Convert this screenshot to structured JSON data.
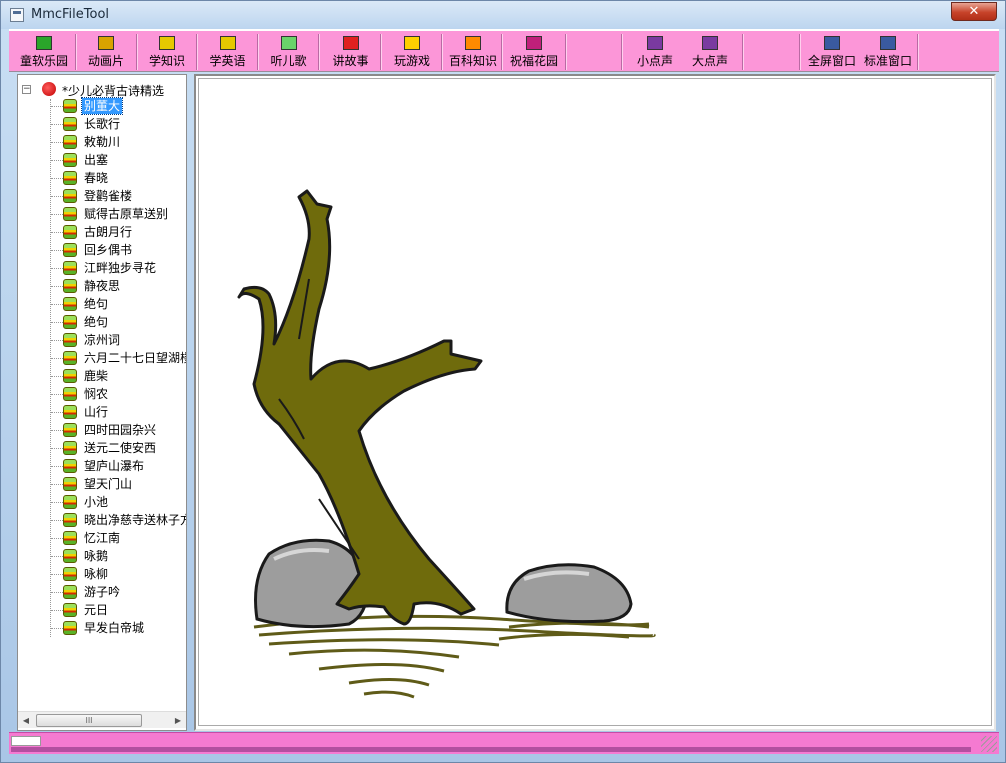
{
  "window": {
    "title": "MmcFileTool",
    "close_glyph": "✕"
  },
  "toolbar": {
    "buttons": [
      {
        "label": "童软乐园",
        "icon": "kids-park-icon",
        "color": "#2aa52a"
      },
      {
        "label": "动画片",
        "icon": "cartoon-icon",
        "color": "#d9a300"
      },
      {
        "label": "学知识",
        "icon": "knowledge-icon",
        "color": "#e6c800"
      },
      {
        "label": "学英语",
        "icon": "english-icon",
        "color": "#e6c800"
      },
      {
        "label": "听儿歌",
        "icon": "song-icon",
        "color": "#6ad26a"
      },
      {
        "label": "讲故事",
        "icon": "story-icon",
        "color": "#e02020"
      },
      {
        "label": "玩游戏",
        "icon": "game-icon",
        "color": "#ffd000"
      },
      {
        "label": "百科知识",
        "icon": "encyclopedia-icon",
        "color": "#ff8a00"
      },
      {
        "label": "祝福花园",
        "icon": "blessing-garden-icon",
        "color": "#c0207a"
      },
      {
        "label": "小点声",
        "icon": "volume-down-icon",
        "color": "#7a3aa0"
      },
      {
        "label": "大点声",
        "icon": "volume-up-icon",
        "color": "#7a3aa0"
      },
      {
        "label": "全屏窗口",
        "icon": "fullscreen-icon",
        "color": "#3a5aa0"
      },
      {
        "label": "标准窗口",
        "icon": "standard-window-icon",
        "color": "#3a5aa0"
      }
    ]
  },
  "tree": {
    "expander": "−",
    "root_label": "*少儿必背古诗精选",
    "selected_index": 0,
    "items": [
      "别董大",
      "长歌行",
      "敕勒川",
      "出塞",
      "春晓",
      "登鹳雀楼",
      "赋得古原草送别",
      "古朗月行",
      "回乡偶书",
      "江畔独步寻花",
      "静夜思",
      "绝句",
      "绝句",
      "凉州词",
      "六月二十七日望湖楼",
      "鹿柴",
      "悯农",
      "山行",
      "四时田园杂兴",
      "送元二使安西",
      "望庐山瀑布",
      "望天门山",
      "小池",
      "晓出净慈寺送林子方",
      "忆江南",
      "咏鹅",
      "咏柳",
      "游子吟",
      "元日",
      "早发白帝城"
    ],
    "scroll_left": "◀",
    "scroll_right": "▶",
    "scroll_thumb": "III"
  },
  "canvas": {
    "illustration": "tree-and-rocks-illustration"
  }
}
